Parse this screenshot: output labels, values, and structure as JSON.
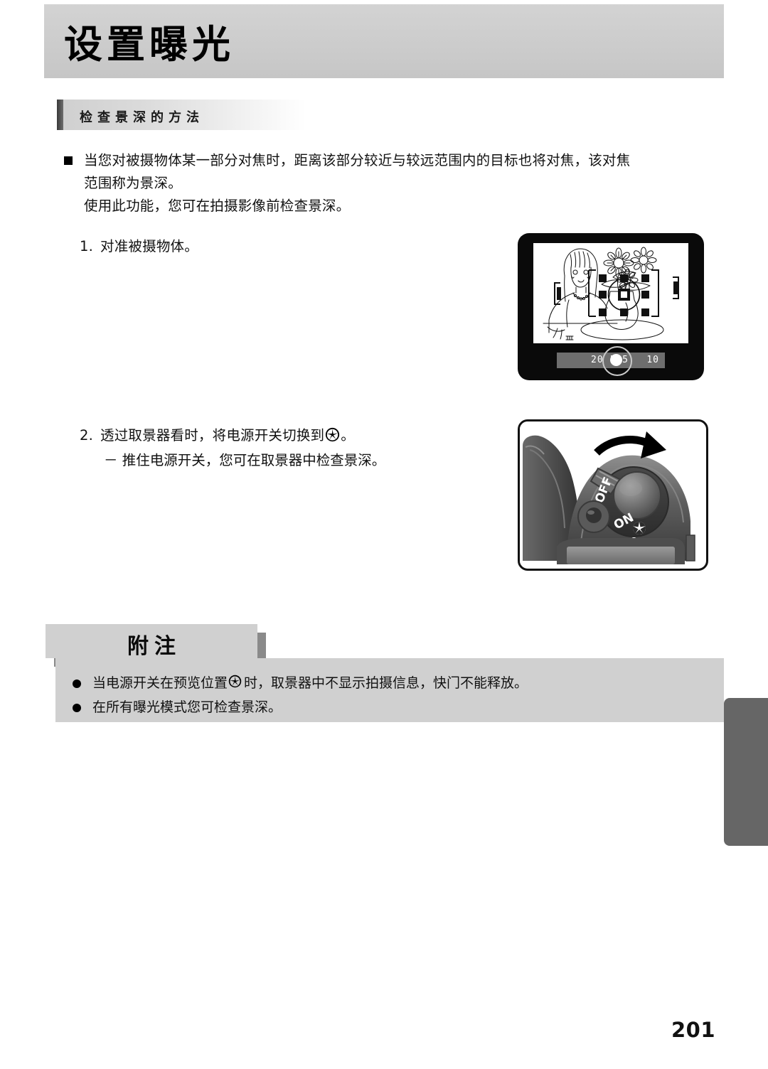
{
  "page": {
    "number": "201",
    "chapter_title": "设置曝光",
    "section_title": "检查景深的方法"
  },
  "body": {
    "bullet_1_line_1": "当您对被摄物体某一部分对焦时，距离该部分较近与较远范围内的目标也将对焦，该对焦",
    "bullet_1_line_2": "范围称为景深。",
    "bullet_1_line_3": "使用此功能，您可在拍摄影像前检查景深。"
  },
  "steps": [
    {
      "number": "1.",
      "text": "对准被摄物体。",
      "icon": null,
      "sub": null
    },
    {
      "number": "2.",
      "text_before_icon": "透过取景器看时，将电源开关切换到",
      "icon": "aperture-preview-icon",
      "text_after_icon": "。",
      "sub": "－ 推住电源开关，您可在取景器中检查景深。"
    }
  ],
  "note": {
    "tab_label": "附注",
    "items": [
      {
        "text_before_icon": "当电源开关在预览位置",
        "icon": "aperture-preview-icon",
        "text_after_icon": "时，取景器中不显示拍摄信息，快门不能释放。"
      },
      {
        "text_before_icon": "在所有曝光模式您可检查景深。",
        "icon": null,
        "text_after_icon": ""
      }
    ]
  },
  "viewfinder": {
    "status_left": "20 F45",
    "status_right": "10",
    "scene_description": "woman-with-flower-vase-line-art",
    "af_points": 9
  },
  "dial": {
    "labels": [
      "OFF",
      "ON"
    ],
    "preview_symbol": "aperture-preview-icon"
  },
  "colors": {
    "header_gray": "#cccccc",
    "note_gray": "#d0d0d0",
    "tab_gray": "#666666",
    "shadow_gray": "#8a8a8a",
    "text_black": "#111111"
  }
}
